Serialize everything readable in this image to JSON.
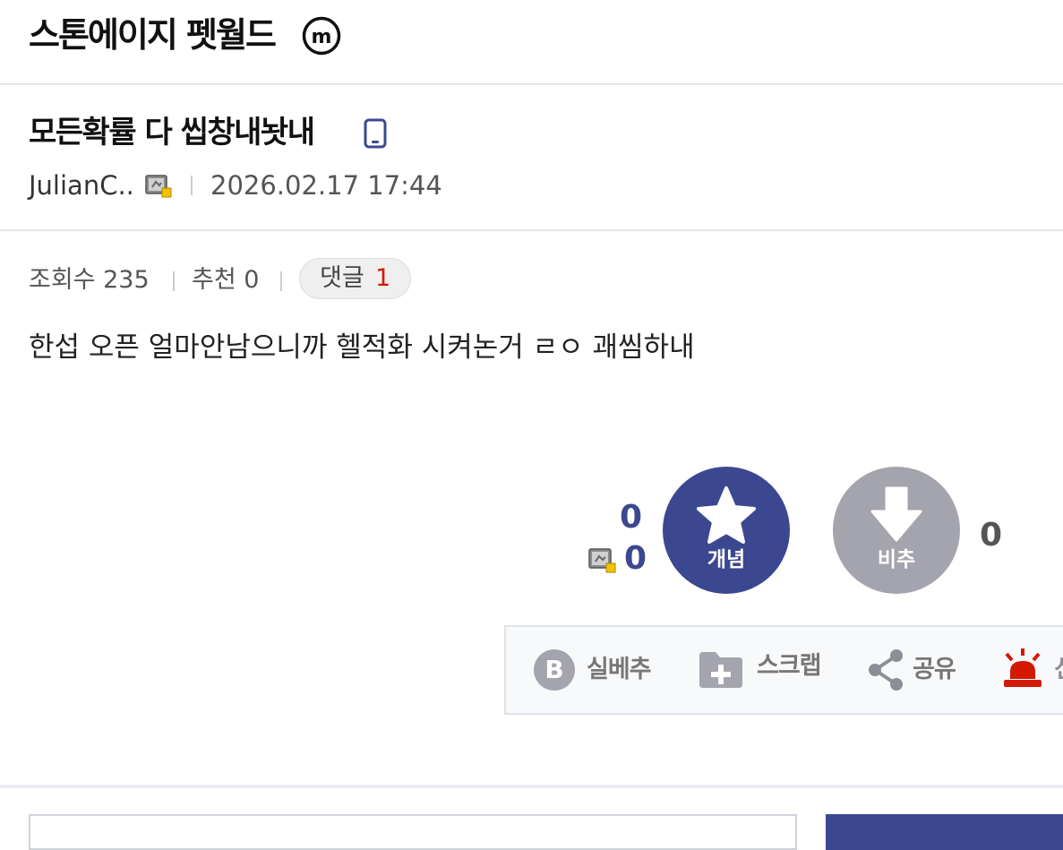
{
  "header": {
    "gallery_title": "스톤에이지 펫월드",
    "badge_letter": "m"
  },
  "post": {
    "title": "모든확률 다 씹창내놧내",
    "writer": "JulianC..",
    "date": "2026.02.17 17:44",
    "body": "한섭 오픈 얼마안남으니까 헬적화 시켜논거 ㄹㅇ 괘씸하내"
  },
  "stats": {
    "views_label": "조회수 235",
    "recommend_label": "추천 0",
    "comments_label": "댓글",
    "comments_count": "1"
  },
  "vote": {
    "recommend_count": "0",
    "fixed_recommend_count": "0",
    "up_label": "개념",
    "down_label": "비추",
    "nonrecommend_count": "0"
  },
  "actions": {
    "best_label": "실베추",
    "scrap_label": "스크랩",
    "share_label": "공유",
    "report_label": "신고"
  },
  "colors": {
    "brand": "#3b4890",
    "downvote": "#a4a4ae",
    "comment_count": "#d31900",
    "report": "#d31900"
  }
}
